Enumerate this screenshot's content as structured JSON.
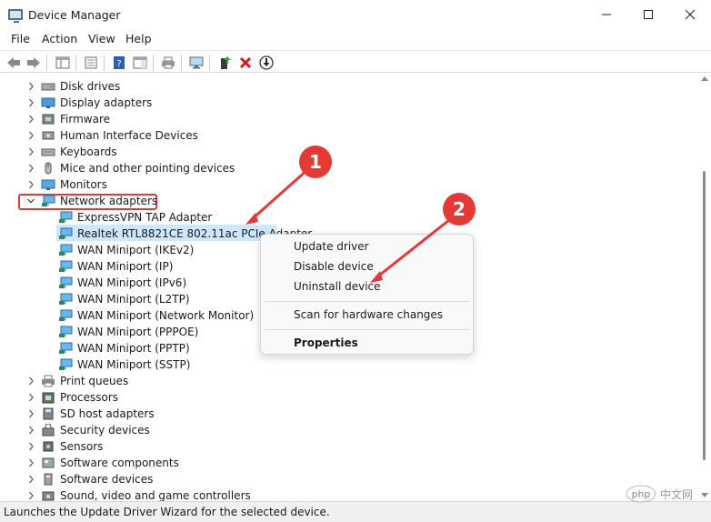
{
  "window": {
    "title": "Device Manager",
    "min_icon": "minimize-icon",
    "max_icon": "maximize-icon",
    "close_icon": "close-icon"
  },
  "menu": [
    "File",
    "Action",
    "View",
    "Help"
  ],
  "tree": {
    "items_before": [
      "Disk drives",
      "Display adapters",
      "Firmware",
      "Human Interface Devices",
      "Keyboards",
      "Mice and other pointing devices",
      "Monitors"
    ],
    "network": {
      "label": "Network adapters",
      "children": [
        "ExpressVPN TAP Adapter",
        "Realtek RTL8821CE 802.11ac PCIe Adapter",
        "WAN Miniport (IKEv2)",
        "WAN Miniport (IP)",
        "WAN Miniport (IPv6)",
        "WAN Miniport (L2TP)",
        "WAN Miniport (Network Monitor)",
        "WAN Miniport (PPPOE)",
        "WAN Miniport (PPTP)",
        "WAN Miniport (SSTP)"
      ]
    },
    "items_after": [
      "Print queues",
      "Processors",
      "SD host adapters",
      "Security devices",
      "Sensors",
      "Software components",
      "Software devices",
      "Sound, video and game controllers"
    ]
  },
  "context_menu": {
    "update": "Update driver",
    "disable": "Disable device",
    "uninstall": "Uninstall device",
    "scan": "Scan for hardware changes",
    "properties": "Properties"
  },
  "annotations": {
    "badge1": "1",
    "badge2": "2"
  },
  "status": "Launches the Update Driver Wizard for the selected device.",
  "watermark": "php 中文网",
  "colors": {
    "accent_red": "#e53935",
    "selection": "#cce8ff"
  }
}
